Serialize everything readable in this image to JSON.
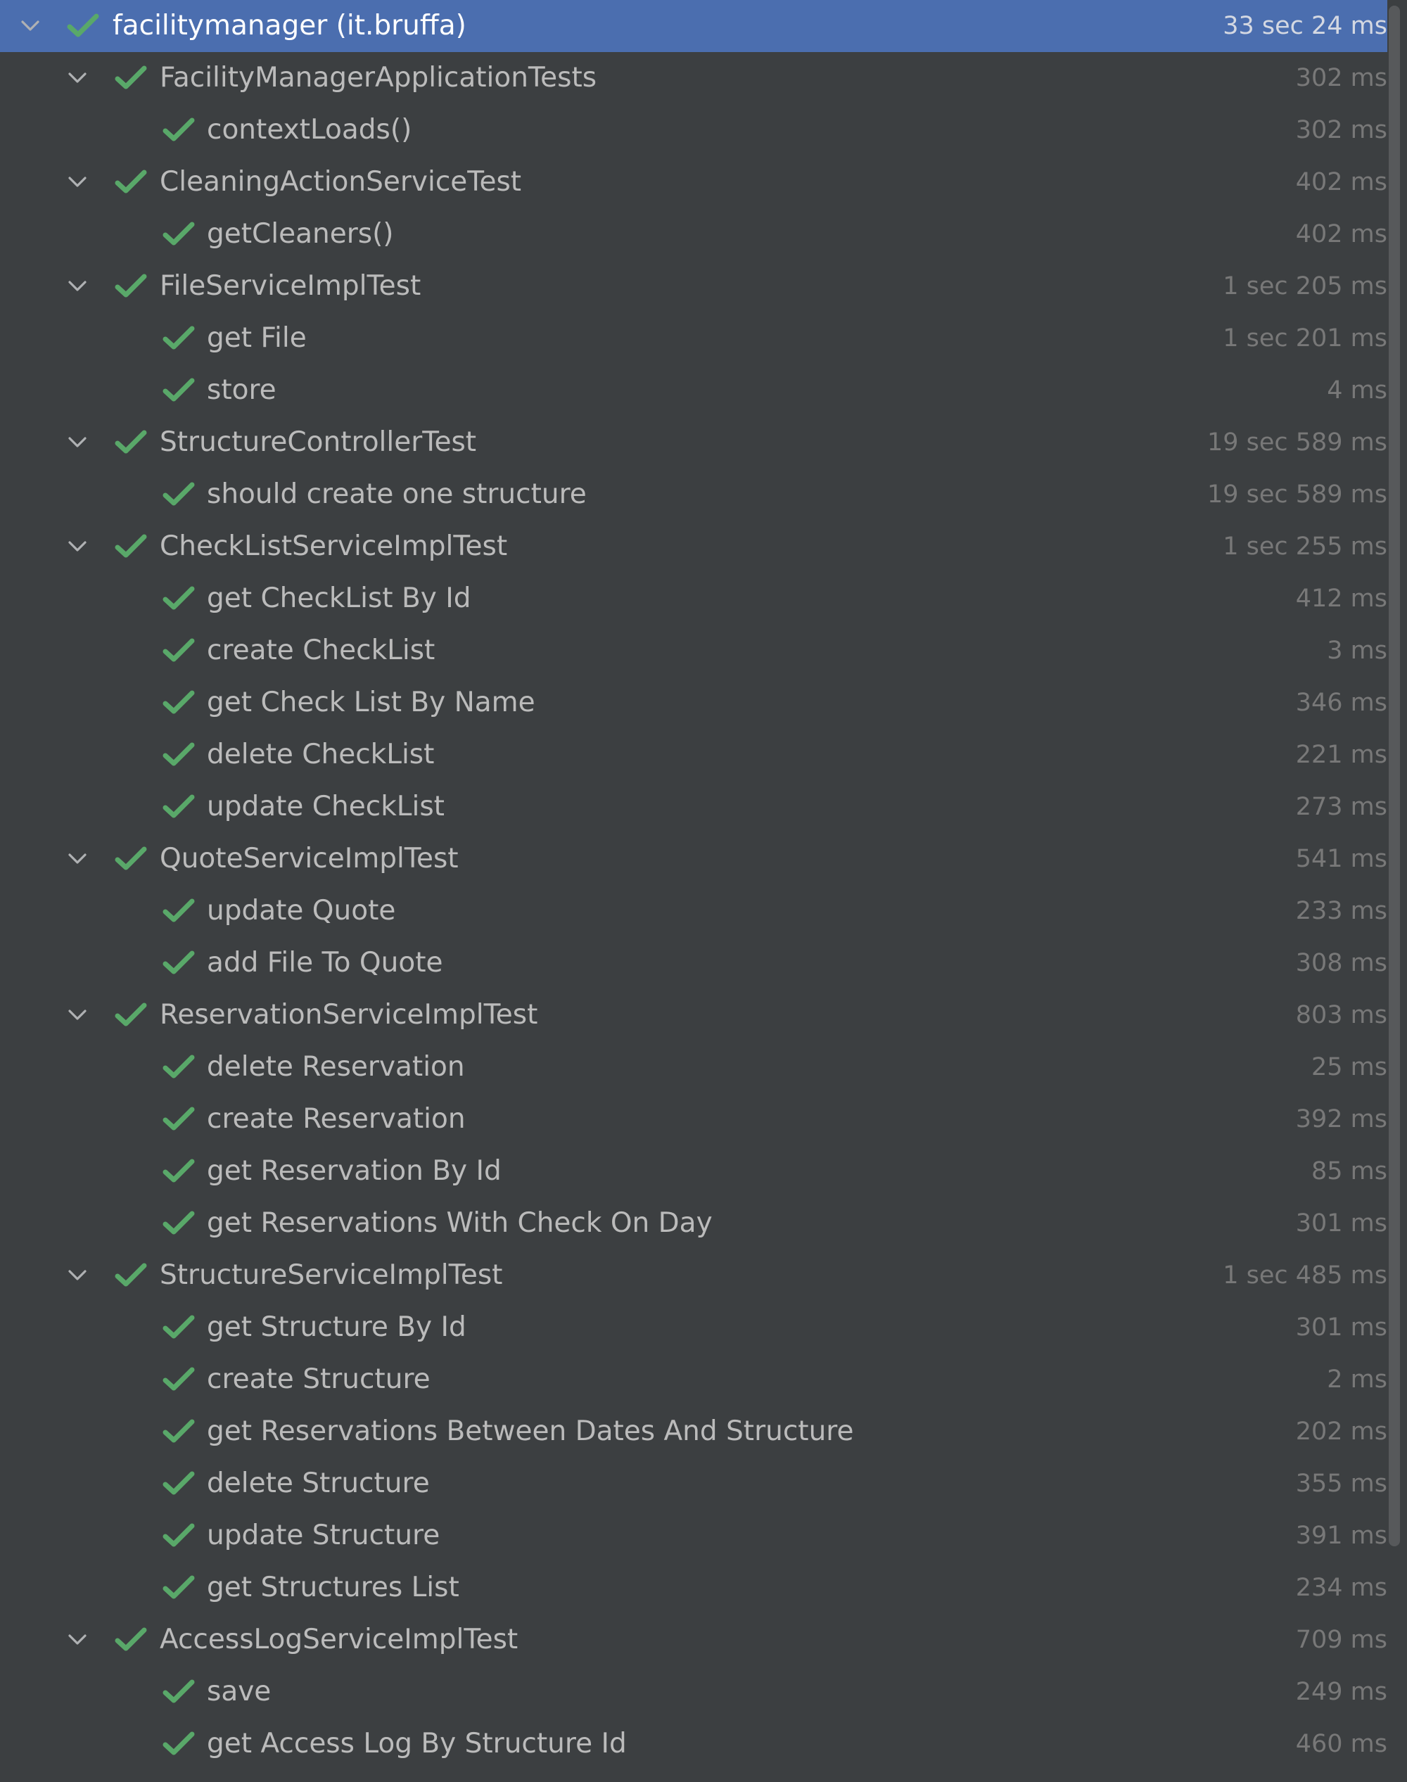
{
  "colors": {
    "background": "#3c3f41",
    "selection": "#4b6eaf",
    "pass_check": "#59a869",
    "text": "#bbbbbb",
    "duration": "#787878"
  },
  "icons": {
    "expand": "chevron-down-icon",
    "status": "check-icon"
  },
  "tree": [
    {
      "label": "facilitymanager (it.bruffa)",
      "time": "33 sec 24 ms",
      "depth": 0,
      "expandable": true,
      "selected": true
    },
    {
      "label": "FacilityManagerApplicationTests",
      "time": "302 ms",
      "depth": 1,
      "expandable": true
    },
    {
      "label": "contextLoads()",
      "time": "302 ms",
      "depth": 2,
      "expandable": false
    },
    {
      "label": "CleaningActionServiceTest",
      "time": "402 ms",
      "depth": 1,
      "expandable": true
    },
    {
      "label": "getCleaners()",
      "time": "402 ms",
      "depth": 2,
      "expandable": false
    },
    {
      "label": "FileServiceImplTest",
      "time": "1 sec 205 ms",
      "depth": 1,
      "expandable": true
    },
    {
      "label": "get File",
      "time": "1 sec 201 ms",
      "depth": 2,
      "expandable": false
    },
    {
      "label": "store",
      "time": "4 ms",
      "depth": 2,
      "expandable": false
    },
    {
      "label": "StructureControllerTest",
      "time": "19 sec 589 ms",
      "depth": 1,
      "expandable": true
    },
    {
      "label": "should create one structure",
      "time": "19 sec 589 ms",
      "depth": 2,
      "expandable": false
    },
    {
      "label": "CheckListServiceImplTest",
      "time": "1 sec 255 ms",
      "depth": 1,
      "expandable": true
    },
    {
      "label": "get CheckList By Id",
      "time": "412 ms",
      "depth": 2,
      "expandable": false
    },
    {
      "label": "create CheckList",
      "time": "3 ms",
      "depth": 2,
      "expandable": false
    },
    {
      "label": "get Check List By Name",
      "time": "346 ms",
      "depth": 2,
      "expandable": false
    },
    {
      "label": "delete CheckList",
      "time": "221 ms",
      "depth": 2,
      "expandable": false
    },
    {
      "label": "update CheckList",
      "time": "273 ms",
      "depth": 2,
      "expandable": false
    },
    {
      "label": "QuoteServiceImplTest",
      "time": "541 ms",
      "depth": 1,
      "expandable": true
    },
    {
      "label": "update Quote",
      "time": "233 ms",
      "depth": 2,
      "expandable": false
    },
    {
      "label": "add File To Quote",
      "time": "308 ms",
      "depth": 2,
      "expandable": false
    },
    {
      "label": "ReservationServiceImplTest",
      "time": "803 ms",
      "depth": 1,
      "expandable": true
    },
    {
      "label": "delete Reservation",
      "time": "25 ms",
      "depth": 2,
      "expandable": false
    },
    {
      "label": "create Reservation",
      "time": "392 ms",
      "depth": 2,
      "expandable": false
    },
    {
      "label": "get Reservation By Id",
      "time": "85 ms",
      "depth": 2,
      "expandable": false
    },
    {
      "label": "get Reservations With Check On Day",
      "time": "301 ms",
      "depth": 2,
      "expandable": false
    },
    {
      "label": "StructureServiceImplTest",
      "time": "1 sec 485 ms",
      "depth": 1,
      "expandable": true
    },
    {
      "label": "get Structure By Id",
      "time": "301 ms",
      "depth": 2,
      "expandable": false
    },
    {
      "label": "create Structure",
      "time": "2 ms",
      "depth": 2,
      "expandable": false
    },
    {
      "label": "get Reservations Between Dates And Structure",
      "time": "202 ms",
      "depth": 2,
      "expandable": false
    },
    {
      "label": "delete Structure",
      "time": "355 ms",
      "depth": 2,
      "expandable": false
    },
    {
      "label": "update Structure",
      "time": "391 ms",
      "depth": 2,
      "expandable": false
    },
    {
      "label": "get Structures List",
      "time": "234 ms",
      "depth": 2,
      "expandable": false
    },
    {
      "label": "AccessLogServiceImplTest",
      "time": "709 ms",
      "depth": 1,
      "expandable": true
    },
    {
      "label": "save",
      "time": "249 ms",
      "depth": 2,
      "expandable": false
    },
    {
      "label": "get Access Log By Structure Id",
      "time": "460 ms",
      "depth": 2,
      "expandable": false
    }
  ]
}
